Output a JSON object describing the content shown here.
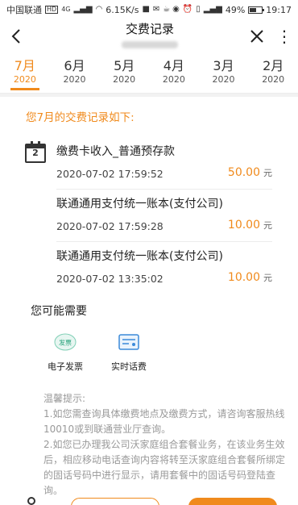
{
  "status_bar": {
    "carrier": "中国联通",
    "hd": "HD",
    "network": "4G",
    "speed": "6.15K/s",
    "battery_pct_text": "49%",
    "battery_level": 0.49,
    "time": "19:17"
  },
  "nav": {
    "title": "交费记录"
  },
  "months": [
    {
      "month": "7月",
      "year": "2020",
      "active": true
    },
    {
      "month": "6月",
      "year": "2020",
      "active": false
    },
    {
      "month": "5月",
      "year": "2020",
      "active": false
    },
    {
      "month": "4月",
      "year": "2020",
      "active": false
    },
    {
      "month": "3月",
      "year": "2020",
      "active": false
    },
    {
      "month": "2月",
      "year": "2020",
      "active": false
    }
  ],
  "records_header": "您7月的交费记录如下:",
  "calendar_day": "2",
  "records": [
    {
      "name": "缴费卡收入_普通预存款",
      "time": "2020-07-02 17:59:52",
      "amount": "50.00",
      "unit": "元"
    },
    {
      "name": "联通通用支付统一账本(支付公司)",
      "time": "2020-07-02 17:59:28",
      "amount": "10.00",
      "unit": "元"
    },
    {
      "name": "联通通用支付统一账本(支付公司)",
      "time": "2020-07-02 13:35:02",
      "amount": "10.00",
      "unit": "元"
    }
  ],
  "suggestions": {
    "title": "您可能需要",
    "items": [
      {
        "label": "电子发票",
        "icon": "invoice-icon",
        "badge": "发票"
      },
      {
        "label": "实时话费",
        "icon": "bill-icon"
      }
    ]
  },
  "tips": {
    "title": "温馨提示:",
    "lines": [
      "1.如您需查询具体缴费地点及缴费方式，请咨询客服热线10010或到联通营业厅查询。",
      "2.如您已办理我公司沃家庭组合套餐业务，在该业务生效后，相应移动电话查询内容将转至沃家庭组合套餐所绑定的固话号码中进行显示，请用套餐中的固话号码登陆查询。"
    ]
  },
  "colors": {
    "accent": "#f08a1c"
  }
}
